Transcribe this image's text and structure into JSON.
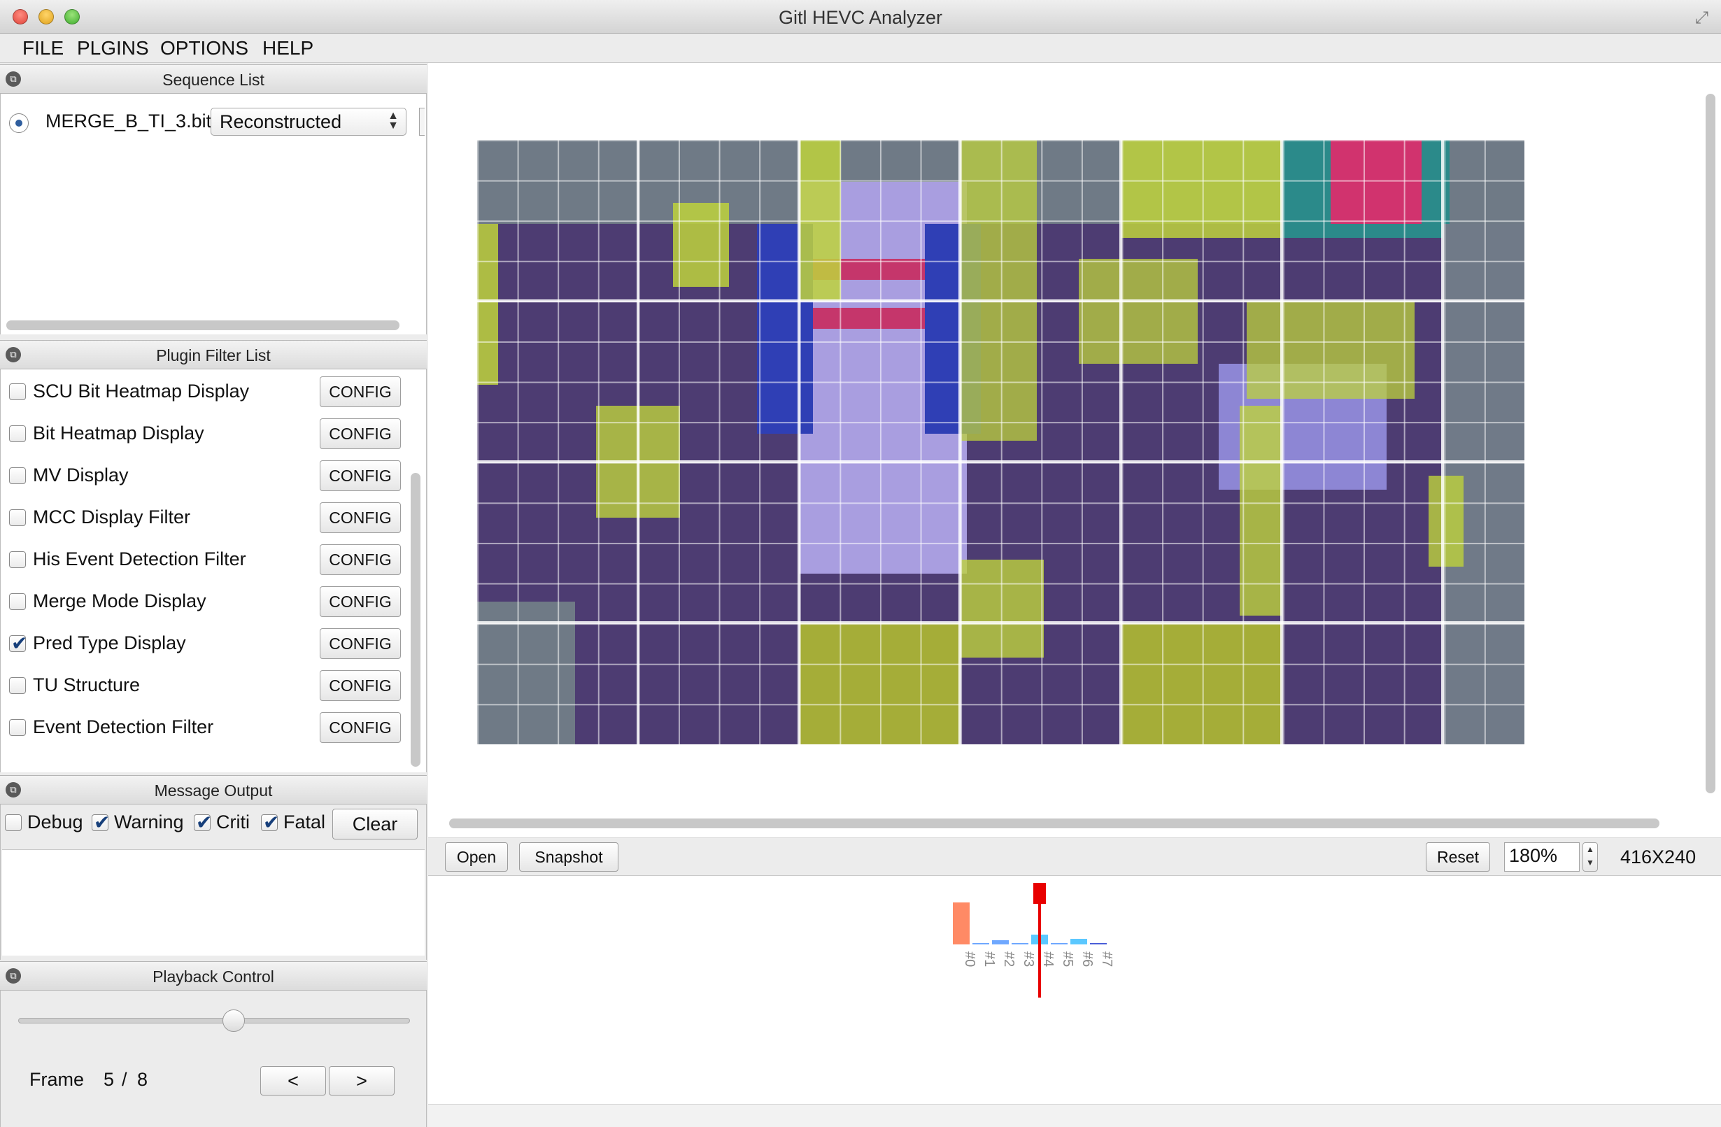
{
  "window": {
    "title": "Gitl HEVC Analyzer"
  },
  "menu": [
    "FILE",
    "PLGINS",
    "OPTIONS",
    "HELP"
  ],
  "sequence_list": {
    "title": "Sequence List",
    "items": [
      {
        "name": "MERGE_B_TI_3.bit",
        "mode": "Reconstructed",
        "selected": true
      }
    ]
  },
  "plugin_filter_list": {
    "title": "Plugin Filter List",
    "config_label": "CONFIG",
    "items": [
      {
        "label": "SCU Bit Heatmap Display",
        "checked": false
      },
      {
        "label": "Bit Heatmap Display",
        "checked": false
      },
      {
        "label": "MV Display",
        "checked": false
      },
      {
        "label": "MCC Display Filter",
        "checked": false
      },
      {
        "label": "His Event Detection Filter",
        "checked": false
      },
      {
        "label": "Merge Mode Display",
        "checked": false
      },
      {
        "label": "Pred Type Display",
        "checked": true
      },
      {
        "label": "TU Structure",
        "checked": false
      },
      {
        "label": "Event Detection Filter",
        "checked": false
      }
    ]
  },
  "message_output": {
    "title": "Message Output",
    "filters": [
      {
        "label": "Debug",
        "checked": false
      },
      {
        "label": "Warning",
        "checked": true
      },
      {
        "label": "Criti",
        "checked": true
      },
      {
        "label": "Fatal",
        "checked": true
      }
    ],
    "clear_label": "Clear"
  },
  "playback": {
    "title": "Playback Control",
    "frame_label": "Frame",
    "current_frame": "5",
    "separator": "/",
    "total_frames": "8",
    "slider_fraction": 0.55,
    "prev_label": "<",
    "next_label": ">"
  },
  "viewer": {
    "open_label": "Open",
    "snapshot_label": "Snapshot",
    "reset_label": "Reset",
    "zoom": "180%",
    "resolution": "416X240"
  },
  "colors": {
    "intra": "#b8cc3a",
    "inter": "#5b3f8c",
    "current_frame_marker": "#e80000"
  },
  "chart_data": {
    "type": "bar",
    "categories": [
      "#0",
      "#1",
      "#2",
      "#3",
      "#4",
      "#5",
      "#6",
      "#7"
    ],
    "values": [
      60,
      1,
      6,
      1,
      14,
      1,
      8,
      2
    ],
    "bar_colors": [
      "#ff8a65",
      "#6fa8ff",
      "#6fa8ff",
      "#6fa8ff",
      "#5bc8ff",
      "#6fa8ff",
      "#5bc8ff",
      "#4a5fd8"
    ],
    "current_index": 4,
    "ylim": [
      0,
      100
    ]
  }
}
